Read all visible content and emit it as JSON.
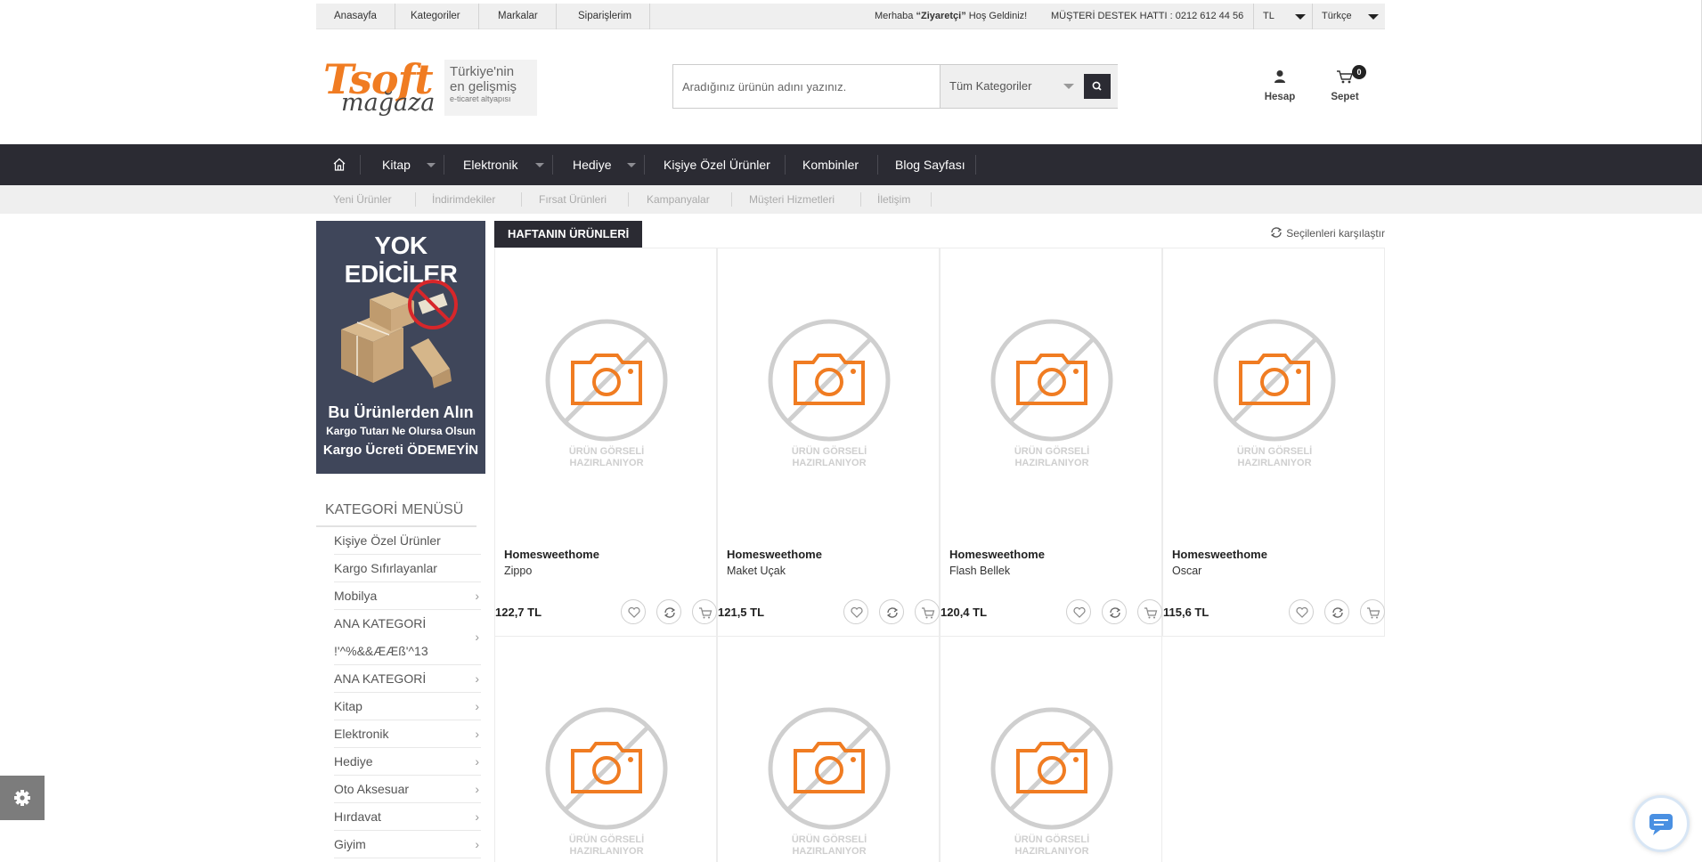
{
  "topbar": {
    "links": [
      "Anasayfa",
      "Kategoriler",
      "Markalar",
      "Siparişlerim"
    ],
    "greeting_prefix": "Merhaba",
    "greeting_name": "“Ziyaretçi”",
    "greeting_suffix": "Hoş Geldiniz!",
    "support": "MÜŞTERİ DESTEK HATTI : 0212 612 44 56",
    "currency": "TL",
    "language": "Türkçe"
  },
  "logo": {
    "brand_top": "Tsoft",
    "brand_bottom": "mağaza",
    "tagline_1": "Türkiye'nin",
    "tagline_2": "en gelişmiş",
    "tagline_3": "e-ticaret altyapısı"
  },
  "search": {
    "placeholder": "Aradığınız ürünün adını yazınız.",
    "category": "Tüm Kategoriler"
  },
  "header_actions": {
    "account_label": "Hesap",
    "cart_label": "Sepet",
    "cart_count": "0"
  },
  "nav": {
    "items": [
      "Kitap",
      "Elektronik",
      "Hediye",
      "Kişiye Özel Ürünler",
      "Kombinler",
      "Blog Sayfası"
    ]
  },
  "subnav": {
    "items": [
      "Yeni Ürünler",
      "İndirimdekiler",
      "Fırsat Ürünleri",
      "Kampanyalar",
      "Müşteri Hizmetleri",
      "İletişim"
    ]
  },
  "banner": {
    "headline": "YOK EDİCİLER",
    "line1": "Bu Ürünlerden Alın",
    "line2": "Kargo Tutarı Ne Olursa Olsun",
    "line3": "Kargo Ücreti ÖDEMEYİN"
  },
  "category_menu": {
    "title": "KATEGORİ MENÜSÜ",
    "items": [
      "Kişiye Özel Ürünler",
      "Kargo Sıfırlayanlar",
      "Mobilya",
      "ANA KATEGORİ",
      "!'^%&&ÆÆß'^13",
      "ANA KATEGORİ",
      "Kitap",
      "Elektronik",
      "Hediye",
      "Oto Aksesuar",
      "Hırdavat",
      "Giyim"
    ]
  },
  "section": {
    "title": "HAFTANIN ÜRÜNLERİ",
    "compare": "Seçilenleri karşılaştır"
  },
  "placeholder_text": {
    "line1": "ÜRÜN GÖRSELİ",
    "line2": "HAZIRLANIYOR"
  },
  "products": [
    {
      "brand": "Homesweethome",
      "name": "Zippo",
      "price": "122,7 TL"
    },
    {
      "brand": "Homesweethome",
      "name": "Maket Uçak",
      "price": "121,5 TL"
    },
    {
      "brand": "Homesweethome",
      "name": "Flash Bellek",
      "price": "120,4 TL"
    },
    {
      "brand": "Homesweethome",
      "name": "Oscar",
      "price": "115,6 TL"
    }
  ],
  "colors": {
    "nav_bg": "#2b2b33",
    "brand_orange": "#f07c22",
    "placeholder_gray": "#cfcfcf"
  }
}
